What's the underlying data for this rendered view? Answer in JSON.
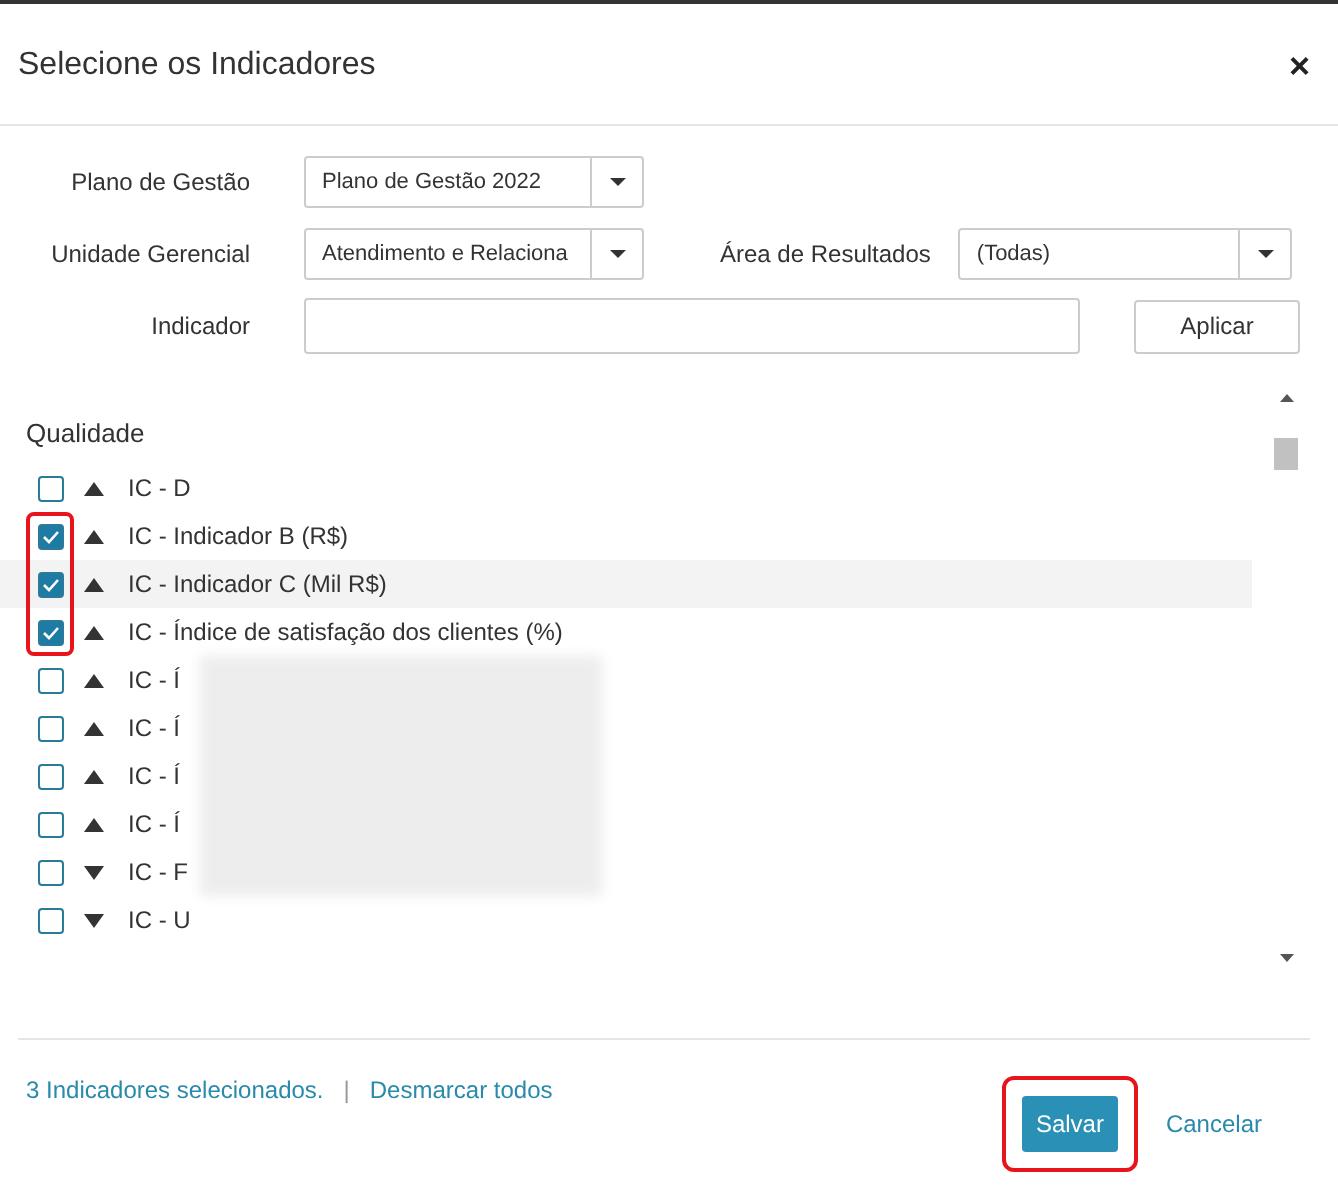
{
  "dialog": {
    "title": "Selecione os Indicadores",
    "close": "×"
  },
  "filters": {
    "plano": {
      "label": "Plano de Gestão",
      "value": "Plano de Gestão 2022"
    },
    "unidade": {
      "label": "Unidade Gerencial",
      "value": "Atendimento e Relaciona"
    },
    "area": {
      "label": "Área de Resultados",
      "value": "(Todas)"
    },
    "indicador": {
      "label": "Indicador"
    },
    "apply": "Aplicar"
  },
  "groups": [
    {
      "name": "Qualidade",
      "items": [
        {
          "label": "IC - D",
          "checked": false,
          "kind": "up",
          "highlighted": false,
          "annotated": false
        },
        {
          "label": "IC - Indicador B (R$)",
          "checked": true,
          "kind": "up",
          "highlighted": false,
          "annotated": true
        },
        {
          "label": "IC - Indicador C (Mil R$)",
          "checked": true,
          "kind": "up",
          "highlighted": true,
          "annotated": true
        },
        {
          "label": "IC - Índice de satisfação dos clientes (%)",
          "checked": true,
          "kind": "up",
          "highlighted": false,
          "annotated": true
        },
        {
          "label": "IC - Í",
          "checked": false,
          "kind": "up",
          "highlighted": false,
          "annotated": false
        },
        {
          "label": "IC - Í",
          "checked": false,
          "kind": "up",
          "highlighted": false,
          "annotated": false
        },
        {
          "label": "IC - Í",
          "checked": false,
          "kind": "up",
          "highlighted": false,
          "annotated": false
        },
        {
          "label": "IC - Í",
          "checked": false,
          "kind": "up",
          "highlighted": false,
          "annotated": false
        },
        {
          "label": "IC - F",
          "checked": false,
          "kind": "down",
          "highlighted": false,
          "annotated": false
        },
        {
          "label": "IC - U",
          "checked": false,
          "kind": "down",
          "highlighted": false,
          "annotated": false
        }
      ]
    }
  ],
  "footer": {
    "count": "3 Indicadores selecionados.",
    "separator": "|",
    "clear": "Desmarcar todos"
  },
  "buttons": [
    {
      "label": "Salvar",
      "kind": "primary",
      "annotated": true
    },
    {
      "label": "Cancelar",
      "kind": "link",
      "annotated": false
    }
  ]
}
